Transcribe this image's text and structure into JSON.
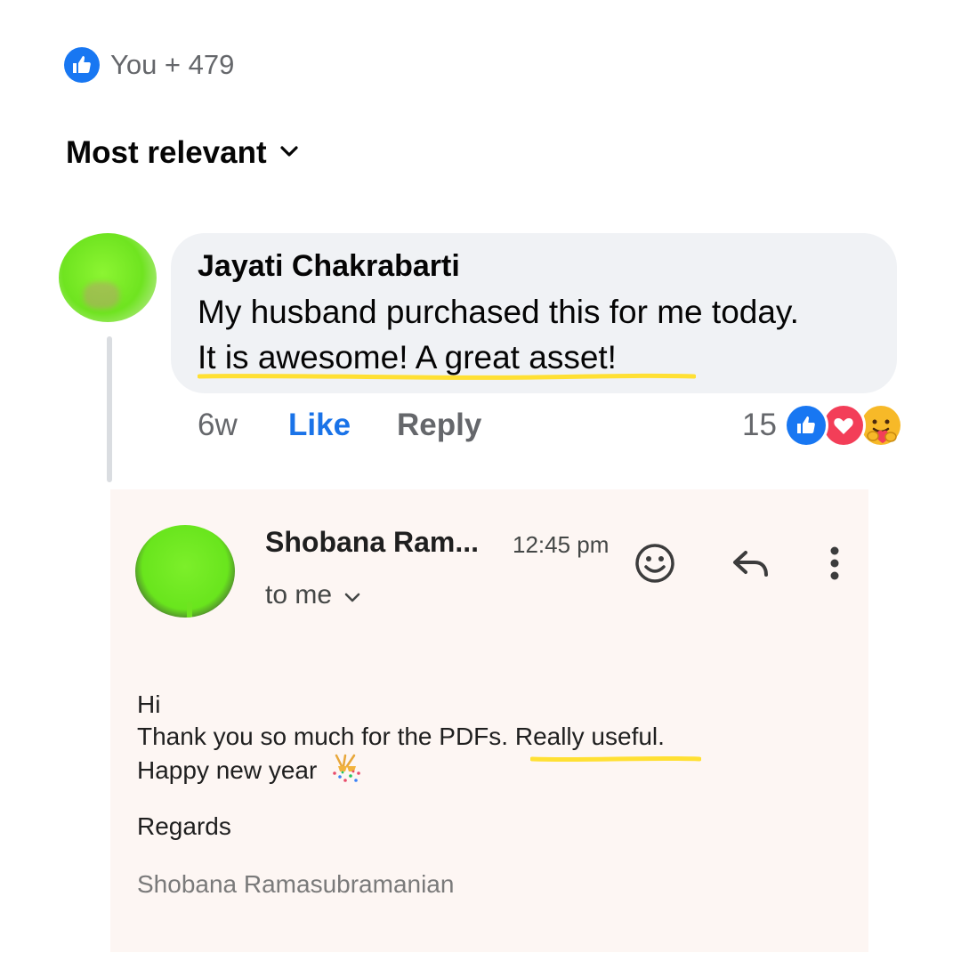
{
  "reactions_summary": {
    "text": "You + 479",
    "icon": "thumbs-up-icon"
  },
  "sort": {
    "label": "Most relevant",
    "icon": "chevron-down-icon"
  },
  "comment": {
    "author": "Jayati Chakrabarti",
    "line1": "My husband purchased this for me today.",
    "line2": "It is awesome! A great asset!",
    "time": "6w",
    "like_label": "Like",
    "reply_label": "Reply",
    "reaction_count": "15",
    "reactions": [
      "like",
      "love",
      "care"
    ]
  },
  "email": {
    "sender": "Shobana Ram...",
    "time": "12:45 pm",
    "recipient": "to me",
    "greeting": "Hi",
    "body_before": "Thank you so much for the PDFs. ",
    "body_highlight": "Really useful.",
    "wish": "Happy new year",
    "regards": "Regards",
    "signature": "Shobana Ramasubramanian",
    "icons": [
      "smiley-icon",
      "reply-arrow-icon",
      "more-vert-icon"
    ]
  },
  "colors": {
    "facebook_blue": "#1877f2",
    "link_blue": "#1a73e8",
    "highlight_yellow": "#ffe033",
    "bubble_gray": "#f0f2f5",
    "email_bg": "#fdf6f3",
    "avatar_green": "#6fe420"
  }
}
